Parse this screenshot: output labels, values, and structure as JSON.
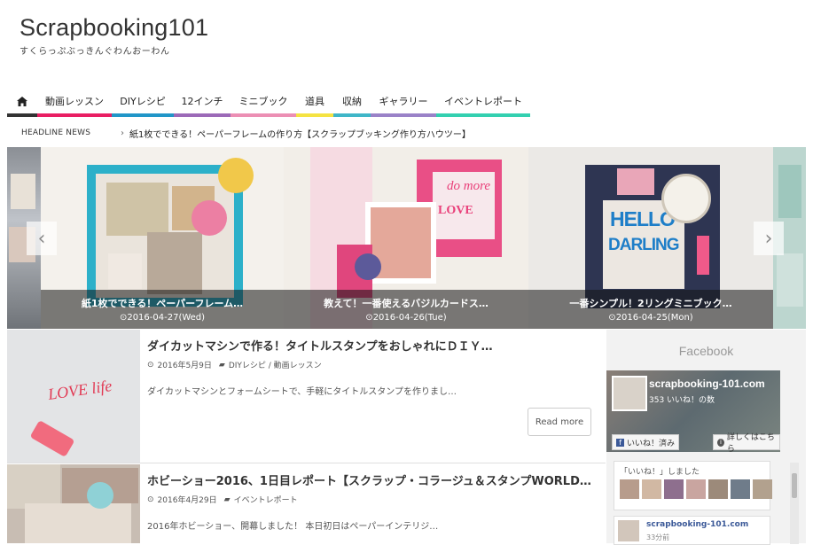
{
  "site": {
    "title": "Scrapbooking101",
    "tagline": "すくらっぷぶっきんぐわんおーわん"
  },
  "nav": {
    "items": [
      {
        "label": "",
        "icon": "home-icon",
        "color": "#333333"
      },
      {
        "label": "動画レッスン",
        "color": "#e91e63"
      },
      {
        "label": "DIYレシピ",
        "color": "#2196c8"
      },
      {
        "label": "12インチ",
        "color": "#9c6ab8"
      },
      {
        "label": "ミニブック",
        "color": "#ec8fb4"
      },
      {
        "label": "道具",
        "color": "#f5e342"
      },
      {
        "label": "収納",
        "color": "#3fb6c8"
      },
      {
        "label": "ギャラリー",
        "color": "#9a82c8"
      },
      {
        "label": "イベントレポート",
        "color": "#33d0b0"
      }
    ]
  },
  "headline": {
    "label": "HEADLINE NEWS",
    "chevron": "›",
    "text": "紙1枚でできる！ペーパーフレームの作り方【スクラップブッキング作り方ハウツー】"
  },
  "slider": {
    "slides": [
      {
        "title": "紙1枚でできる！ペーパーフレーム…",
        "date": "2016-04-27(Wed)"
      },
      {
        "title": "教えて！一番使えるバジルカードス…",
        "date": "2016-04-26(Tue)"
      },
      {
        "title": "一番シンプル！2リングミニブック…",
        "date": "2016-04-25(Mon)"
      }
    ],
    "prev": "‹",
    "next": "›"
  },
  "posts": [
    {
      "title": "ダイカットマシンで作る！タイトルスタンプをおしゃれにＤＩＹ…",
      "date": "2016年5月9日",
      "category": "DIYレシピ / 動画レッスン",
      "excerpt": "ダイカットマシンとフォームシートで、手軽にタイトルスタンプを作りまし…",
      "more": "Read more",
      "thumb_text": "LOVE life"
    },
    {
      "title": "ホビーショー2016、1日目レポート【スクラップ・コラージュ＆スタンプWORLD…",
      "date": "2016年4月29日",
      "category": "イベントレポート",
      "excerpt": "2016年ホビーショー、開幕しました！ 本日初日はペーパーインテリジ…"
    }
  ],
  "sidebar": {
    "title": "Facebook",
    "fb": {
      "page_name": "scrapbooking-101.com",
      "likes": "353 いいね！の数",
      "like_button": "いいね！済み",
      "info_button": "詳しくはこちら",
      "liked_text": "「いいね！」しました",
      "page_link": "scrapbooking-101.com",
      "time": "33分前"
    }
  },
  "colors": {
    "accent": "#e91e63",
    "fb_blue": "#3b5998"
  }
}
